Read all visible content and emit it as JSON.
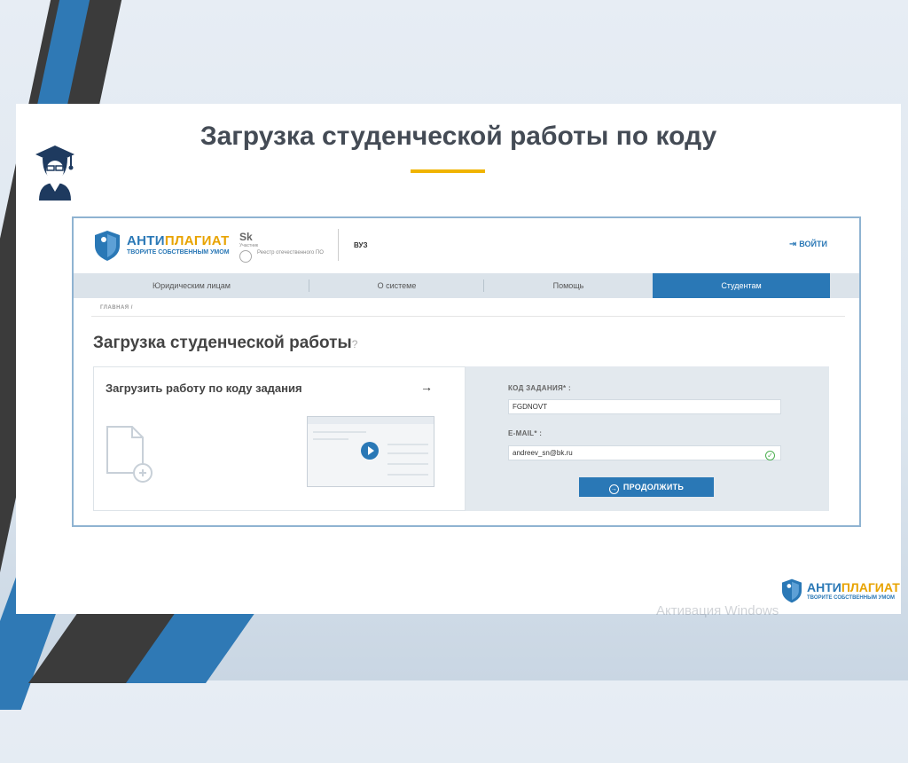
{
  "slide": {
    "title": "Загрузка студенческой работы по коду"
  },
  "site": {
    "brand_part1": "АНТИ",
    "brand_part2": "ПЛАГИАТ",
    "slogan": "ТВОРИТЕ СОБСТВЕННЫМ УМОМ",
    "sk_mark": "Sk",
    "sk_desc": "Участник",
    "registry": "Реестр отечественного ПО",
    "vuz_label": "ВУЗ",
    "login_label": "ВОЙТИ"
  },
  "nav": {
    "items": [
      {
        "label": "Юридическим лицам"
      },
      {
        "label": "О системе"
      },
      {
        "label": "Помощь"
      },
      {
        "label": "Студентам",
        "active": true
      }
    ]
  },
  "breadcrumb": "ГЛАВНАЯ /",
  "page": {
    "heading": "Загрузка студенческой работы",
    "help_icon": "?"
  },
  "card": {
    "title": "Загрузить работу по коду задания",
    "arrow": "→"
  },
  "form": {
    "code_label": "КОД ЗАДАНИЯ* :",
    "code_value": "FGDNOVT",
    "email_label": "E-MAIL* :",
    "email_value": "andreev_sn@bk.ru",
    "submit_label": "ПРОДОЛЖИТЬ"
  },
  "footer_logo": {
    "brand_part1": "АНТИ",
    "brand_part2": "ПЛАГИАТ",
    "slogan": "ТВОРИТЕ СОБСТВЕННЫМ УМОМ"
  },
  "watermark": "Активация Windows",
  "colors": {
    "accent": "#2a78b6",
    "brand_orange": "#e8a300",
    "title_underline": "#f0b400",
    "success": "#4caf50"
  }
}
